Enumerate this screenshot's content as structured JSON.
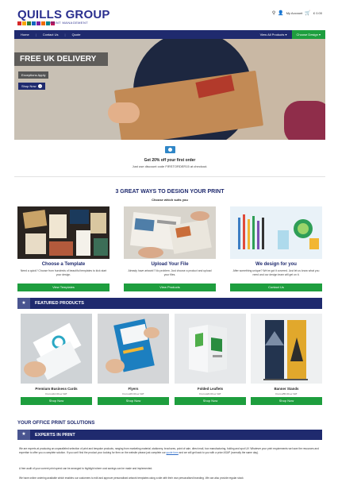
{
  "header": {
    "logo_text": "QUILLS GROUP",
    "logo_sub": "PRINT MANAGEMENT",
    "logo_colors": [
      "#d62828",
      "#f7a600",
      "#2e7d32",
      "#1565c0",
      "#7b1fa2",
      "#ef6c00",
      "#00838f",
      "#c2185b"
    ],
    "account": "My Account",
    "cart": "£ 0.00"
  },
  "nav": {
    "items": [
      "Home",
      "Contact Us",
      "Quote"
    ],
    "products": "View All Products ▾",
    "design": "Choose Design ▾"
  },
  "hero": {
    "banner": "FREE UK DELIVERY",
    "exceptions": "Exceptions Apply",
    "shop_now": "Shop Now"
  },
  "discount": {
    "title": "Get 20% off your first order",
    "subtitle": "Just use discount code FIRSTORDER15 at checkout."
  },
  "ways": {
    "title": "3 GREAT WAYS TO DESIGN YOUR PRINT",
    "subtitle": "Choose which suits you",
    "items": [
      {
        "title": "Choose a Template",
        "desc": "Need a quick? Choose from hundreds of beautiful templates to kick start your design.",
        "button": "View Templates"
      },
      {
        "title": "Upload Your File",
        "desc": "Already have artwork? No problem. Just choose a product and upload your files.",
        "button": "View Products"
      },
      {
        "title": "We design for you",
        "desc": "After something unique? We've got it covered. Just let us know what you need and our design team will get on it.",
        "button": "Contact Us"
      }
    ]
  },
  "featured": {
    "title": "FEATURED PRODUCTS",
    "products": [
      {
        "name": "Premium Business Cards",
        "price": "From £12.00 ex VAT",
        "button": "Shop Now"
      },
      {
        "name": "Flyers",
        "price": "From £15.00 ex VAT",
        "button": "Shop Now"
      },
      {
        "name": "Folded Leaflets",
        "price": "From £24.00 ex VAT",
        "button": "Shop Now"
      },
      {
        "name": "Banner Stands",
        "price": "From £55.00 ex VAT",
        "button": "Shop Now"
      }
    ]
  },
  "office": {
    "title": "YOUR OFFICE PRINT SOLUTIONS",
    "expert_title": "EXPERTS IN PRINT",
    "para1_a": "We are experts at producing an unparalleled selection of print and bespoke products, ranging from marketing material, stationery, brochures, point of sale, direct mail, box manufacturing, folding and spot UV. Whatever your print requirements we have the resources and expertise to offer you a complete solution. If you can't find the product your looking for then on the website please just complete our ",
    "para1_link": "quote form",
    "para1_b": " and we will get back to you with a price ASAP (normally the same day).",
    "para2": "A free audit of your current print spend can be arranged to highlight where cost savings can be made and implemented.",
    "para3": "We have online ordering available which enables our customers to edit and approve personalised artwork templates using a site with their own personalised branding. We can also provide regular stock"
  }
}
